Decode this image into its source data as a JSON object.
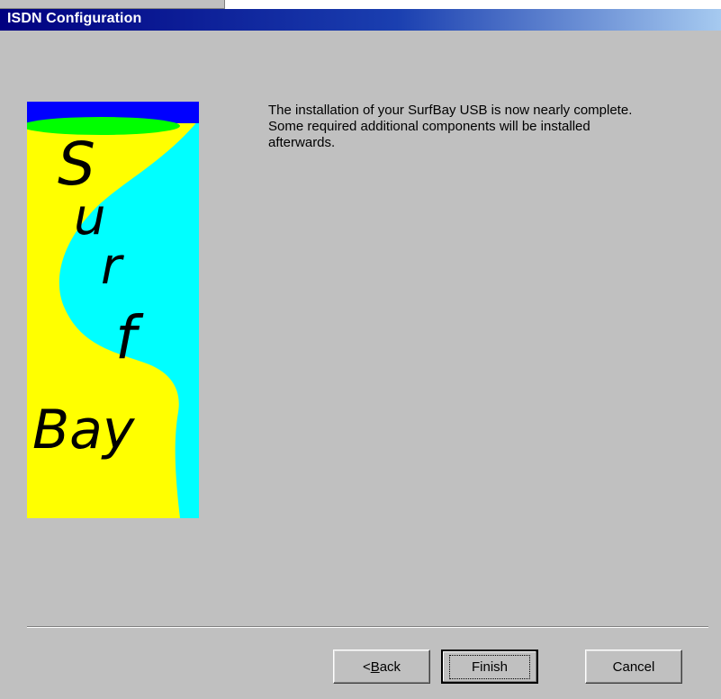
{
  "window": {
    "title": "ISDN Configuration"
  },
  "banner": {
    "logo_text": [
      "S",
      "u",
      "r",
      "f",
      "Bay"
    ],
    "colors": {
      "top_bar": "#0000ff",
      "ellipse": "#00ff00",
      "left_field": "#ffff00",
      "right_wave": "#00ffff",
      "text": "#000000"
    }
  },
  "message": {
    "text": "The installation of your SurfBay USB is now nearly complete. Some required additional components will be installed afterwards."
  },
  "buttons": {
    "back_prefix": "< ",
    "back_mnemonic": "B",
    "back_rest": "ack",
    "finish": "Finish",
    "cancel": "Cancel"
  },
  "colors": {
    "dialog_bg": "#c0c0c0",
    "titlebar_start": "#000080",
    "titlebar_end": "#a6caf0"
  }
}
